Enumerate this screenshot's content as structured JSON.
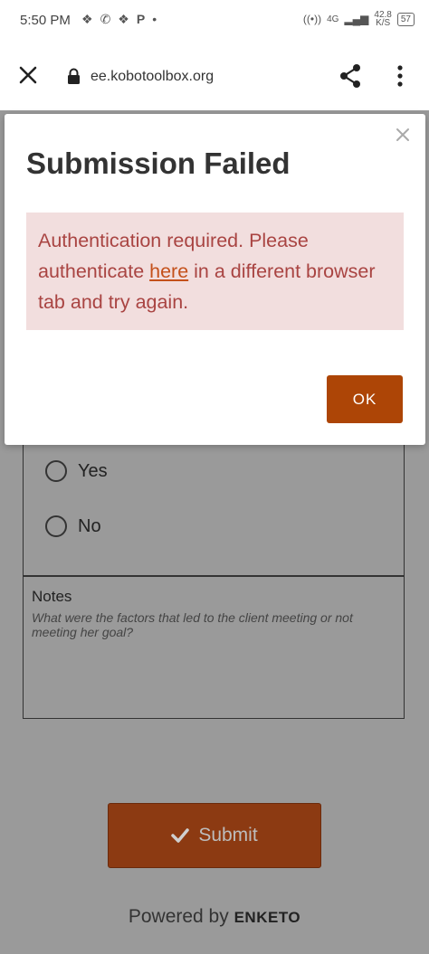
{
  "status_bar": {
    "time": "5:50 PM",
    "network": "4G",
    "speed_value": "42.8",
    "speed_unit": "K/S",
    "battery": "57"
  },
  "browser": {
    "url": "ee.kobotoolbox.org",
    "icons": [
      "close-icon",
      "lock-icon",
      "share-icon",
      "more-vert-icon"
    ]
  },
  "modal": {
    "title": "Submission Failed",
    "message_before_link": "Authentication required. Please authenticate ",
    "link_text": "here",
    "message_after_link": " in a different browser tab and try again.",
    "ok_label": "OK",
    "colors": {
      "alert_bg": "#f2dede",
      "alert_text": "#a94442",
      "ok_bg": "#ad4506"
    }
  },
  "form": {
    "options": [
      "Yes",
      "No"
    ],
    "notes_label": "Notes",
    "notes_hint": "What were the factors that led to the client meeting or not meeting her goal?",
    "submit_label": "Submit",
    "powered_by": "Powered by",
    "brand": "ENKETO"
  }
}
